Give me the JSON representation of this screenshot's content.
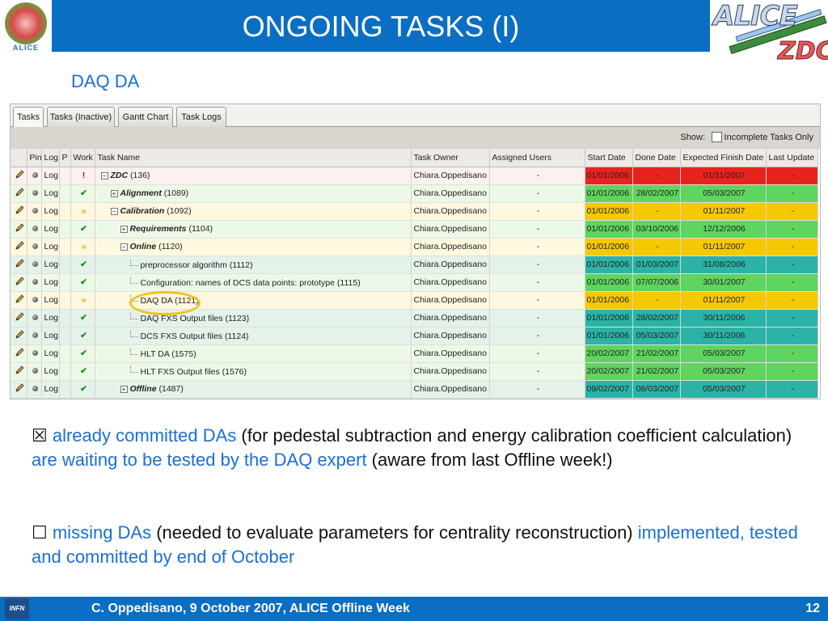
{
  "slide": {
    "title": "ONGOING TASKS (I)",
    "subtitle": "DAQ DA",
    "logo_left_caption": "ALICE",
    "logo_right_top": "ALICE",
    "logo_right_bottom": "ZDC"
  },
  "app": {
    "tabs": [
      {
        "label": "Tasks",
        "active": true
      },
      {
        "label": "Tasks (Inactive)",
        "active": false
      },
      {
        "label": "Gantt Chart",
        "active": false
      },
      {
        "label": "Task Logs",
        "active": false
      }
    ],
    "toolbar": {
      "show_label": "Show:",
      "filter_label": "Incomplete Tasks Only",
      "filter_checked": false
    },
    "columns": [
      "Pin",
      "Log",
      "P",
      "Work",
      "Task Name",
      "Task Owner",
      "Assigned Users",
      "Start Date",
      "Done Date",
      "Expected Finish Date",
      "Last Update"
    ],
    "rows": [
      {
        "log": "Log",
        "status": "!",
        "status_icon": "alert-icon",
        "expander": "−",
        "name": "ZDC",
        "id": "(136)",
        "bold": true,
        "depth": 0,
        "owner": "Chiara.Oppedisano",
        "assigned": "-",
        "start": "01/01/2006",
        "done": "-",
        "finish": "01/11/2007",
        "update": "-",
        "row_color": "#fdf0f0",
        "color": "#e8231e"
      },
      {
        "log": "Log",
        "status": "✔",
        "status_icon": "check-icon",
        "expander": "+",
        "name": "Alignment",
        "id": "(1089)",
        "bold": true,
        "depth": 1,
        "owner": "Chiara.Oppedisano",
        "assigned": "-",
        "start": "01/01/2006",
        "done": "28/02/2007",
        "finish": "05/03/2007",
        "update": "-",
        "row_color": "#edf9e8",
        "color": "#5fd45f"
      },
      {
        "log": "Log",
        "status": "»",
        "status_icon": "in-progress-icon",
        "expander": "−",
        "name": "Calibration",
        "id": "(1092)",
        "bold": true,
        "depth": 1,
        "owner": "Chiara.Oppedisano",
        "assigned": "-",
        "start": "01/01/2006",
        "done": "-",
        "finish": "01/11/2007",
        "update": "-",
        "row_color": "#fff8e0",
        "color": "#f5c800"
      },
      {
        "log": "Log",
        "status": "✔",
        "status_icon": "check-icon",
        "expander": "+",
        "name": "Requirements",
        "id": "(1104)",
        "bold": true,
        "depth": 2,
        "owner": "Chiara.Oppedisano",
        "assigned": "-",
        "start": "01/01/2006",
        "done": "03/10/2006",
        "finish": "12/12/2006",
        "update": "-",
        "row_color": "#edf9e8",
        "color": "#5fd45f"
      },
      {
        "log": "Log",
        "status": "»",
        "status_icon": "in-progress-icon",
        "expander": "−",
        "name": "Online",
        "id": "(1120)",
        "bold": true,
        "depth": 2,
        "owner": "Chiara.Oppedisano",
        "assigned": "-",
        "start": "01/01/2006",
        "done": "-",
        "finish": "01/11/2007",
        "update": "-",
        "row_color": "#fff8e0",
        "color": "#f5c800"
      },
      {
        "log": "Log",
        "status": "✔",
        "status_icon": "check-icon",
        "expander": "",
        "name": "preprocessor algorithm",
        "id": "(1112)",
        "bold": false,
        "depth": 3,
        "owner": "Chiara.Oppedisano",
        "assigned": "-",
        "start": "01/01/2006",
        "done": "01/03/2007",
        "finish": "31/08/2006",
        "update": "-",
        "row_color": "#e4f2ea",
        "color": "#2ab3a6"
      },
      {
        "log": "Log",
        "status": "✔",
        "status_icon": "check-icon",
        "expander": "",
        "name": "Configuration: names of DCS data points: prototype",
        "id": "(1115)",
        "bold": false,
        "depth": 3,
        "owner": "Chiara.Oppedisano",
        "assigned": "-",
        "start": "01/01/2006",
        "done": "07/07/2006",
        "finish": "30/01/2007",
        "update": "-",
        "row_color": "#edf9e8",
        "color": "#5fd45f"
      },
      {
        "log": "Log",
        "status": "»",
        "status_icon": "in-progress-icon",
        "expander": "",
        "name": "DAQ DA",
        "id": "(1121)",
        "bold": false,
        "depth": 3,
        "owner": "Chiara.Oppedisano",
        "assigned": "-",
        "start": "01/01/2006",
        "done": "-",
        "finish": "01/11/2007",
        "update": "-",
        "row_color": "#fff8e0",
        "color": "#f5c800"
      },
      {
        "log": "Log",
        "status": "✔",
        "status_icon": "check-icon",
        "expander": "",
        "name": "DAQ FXS Output files",
        "id": "(1123)",
        "bold": false,
        "depth": 3,
        "owner": "Chiara.Oppedisano",
        "assigned": "-",
        "start": "01/01/2006",
        "done": "28/02/2007",
        "finish": "30/11/2006",
        "update": "-",
        "row_color": "#e4f2ea",
        "color": "#2ab3a6"
      },
      {
        "log": "Log",
        "status": "✔",
        "status_icon": "check-icon",
        "expander": "",
        "name": "DCS FXS Output files",
        "id": "(1124)",
        "bold": false,
        "depth": 3,
        "owner": "Chiara.Oppedisano",
        "assigned": "-",
        "start": "01/01/2006",
        "done": "05/03/2007",
        "finish": "30/11/2006",
        "update": "-",
        "row_color": "#e4f2ea",
        "color": "#2ab3a6"
      },
      {
        "log": "Log",
        "status": "✔",
        "status_icon": "check-icon",
        "expander": "",
        "name": "HLT DA",
        "id": "(1575)",
        "bold": false,
        "depth": 3,
        "owner": "Chiara.Oppedisano",
        "assigned": "-",
        "start": "20/02/2007",
        "done": "21/02/2007",
        "finish": "05/03/2007",
        "update": "-",
        "row_color": "#edf9e8",
        "color": "#5fd45f"
      },
      {
        "log": "Log",
        "status": "✔",
        "status_icon": "check-icon",
        "expander": "",
        "name": "HLT FXS Output files",
        "id": "(1576)",
        "bold": false,
        "depth": 3,
        "owner": "Chiara.Oppedisano",
        "assigned": "-",
        "start": "20/02/2007",
        "done": "21/02/2007",
        "finish": "05/03/2007",
        "update": "-",
        "row_color": "#edf9e8",
        "color": "#5fd45f"
      },
      {
        "log": "Log",
        "status": "✔",
        "status_icon": "check-icon",
        "expander": "+",
        "name": "Offline",
        "id": "(1487)",
        "bold": true,
        "depth": 2,
        "owner": "Chiara.Oppedisano",
        "assigned": "-",
        "start": "09/02/2007",
        "done": "08/03/2007",
        "finish": "05/03/2007",
        "update": "-",
        "row_color": "#e4f2ea",
        "color": "#2ab3a6"
      }
    ],
    "colors": {
      "red": "#e8231e",
      "green": "#5fd45f",
      "yellow": "#f5c800",
      "teal": "#2ab3a6",
      "check": "#1e8a1e",
      "alert": "#cc0000",
      "in_progress": "#f0a000"
    }
  },
  "text": {
    "p1_box": "☒",
    "p1_a": "already committed DAs",
    "p1_b": " (for pedestal subtraction and energy calibration coefficient calculation) ",
    "p1_c": "are waiting to be tested by the DAQ expert",
    "p1_d": " (aware from last Offline week!)",
    "p2_box": "☐",
    "p2_a": "missing DAs",
    "p2_b": " (needed to evaluate parameters for centrality reconstruction) ",
    "p2_c": "implemented, tested and committed by end of October"
  },
  "footer": {
    "logo": "INFN",
    "text": "C. Oppedisano, 9 October 2007, ALICE Offline Week",
    "page": "12"
  }
}
